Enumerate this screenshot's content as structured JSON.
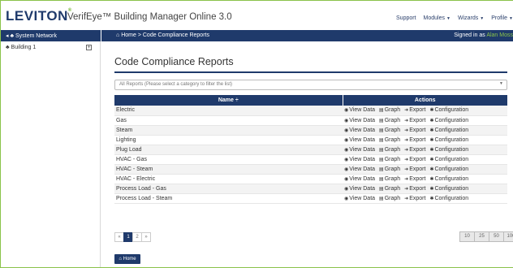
{
  "header": {
    "brand": "LEVITON",
    "app_title": "VerifEye™ Building Manager Online 3.0",
    "nav": [
      "Support",
      "Modules",
      "Wizards",
      "Profile"
    ]
  },
  "sidebar": {
    "heading": "System Network",
    "items": [
      {
        "label": "Building 1"
      }
    ]
  },
  "breadcrumb": {
    "home": "Home",
    "separator": ">",
    "current": "Code Compliance Reports",
    "signed_prefix": "Signed in as",
    "user": "Alan Moss"
  },
  "main": {
    "title": "Code Compliance Reports",
    "filter_placeholder": "All Reports (Please select a category to filter the list)",
    "table": {
      "col_name": "Name ÷",
      "col_actions": "Actions",
      "actions": [
        "View Data",
        "Graph",
        "Export",
        "Configuration"
      ],
      "rows": [
        "Electric",
        "Gas",
        "Steam",
        "Lighting",
        "Plug Load",
        "HVAC - Gas",
        "HVAC - Steam",
        "HVAC - Electric",
        "Process Load - Gas",
        "Process Load - Steam"
      ]
    },
    "pagination": {
      "prev": "«",
      "pages": [
        "1",
        "2"
      ],
      "next": "»",
      "active": "1"
    },
    "page_sizes": [
      "10",
      "25",
      "50",
      "100"
    ],
    "home_button": "Home"
  },
  "colors": {
    "navy": "#1f3a6b",
    "green": "#8bc34a"
  },
  "icons": {
    "view": "eye-icon",
    "graph": "chart-icon",
    "export": "export-icon",
    "config": "gear-icon",
    "home": "home-icon",
    "network": "network-icon"
  }
}
